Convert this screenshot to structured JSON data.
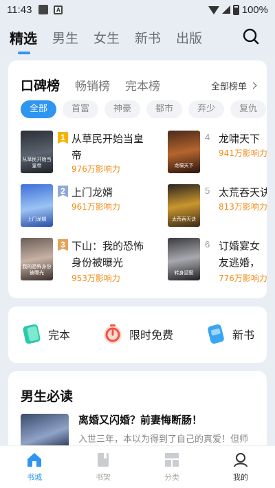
{
  "status": {
    "time": "11:43",
    "battery": "100%"
  },
  "nav": {
    "tabs": [
      "精选",
      "男生",
      "女生",
      "新书",
      "出版"
    ],
    "active": 0
  },
  "ranking": {
    "tabs": [
      "口碑榜",
      "畅销榜",
      "完本榜"
    ],
    "all_label": "全部榜单",
    "chips": [
      "全部",
      "首富",
      "神豪",
      "都市",
      "弃少",
      "复仇"
    ],
    "books": [
      {
        "rank": "1",
        "title": "从草民开始当皇帝",
        "heat": "976万影响力",
        "cover_text": "从草民开始当皇帝"
      },
      {
        "rank": "2",
        "title": "上门龙婿",
        "heat": "961万影响力",
        "cover_text": "上门龙婿"
      },
      {
        "rank": "3",
        "title": "下山：我的恐怖身份被曝光",
        "heat": "953万影响力",
        "cover_text": "我的恐怖身份被曝光"
      },
      {
        "rank": "4",
        "title": "龙啸天下",
        "heat": "941万影响力",
        "cover_text": "龙啸天下"
      },
      {
        "rank": "5",
        "title": "太荒吞天诀",
        "heat": "813万影响力",
        "cover_text": "太荒吞天诀"
      },
      {
        "rank": "6",
        "title": "订婚宴女友逃婚，我，转身",
        "heat": "776万影响力",
        "cover_text": "转身迎娶"
      }
    ]
  },
  "quick": [
    {
      "label": "完本",
      "icon": "book-complete-icon"
    },
    {
      "label": "限时免费",
      "icon": "timer-icon"
    },
    {
      "label": "新书",
      "icon": "new-book-icon"
    }
  ],
  "must_read": {
    "title": "男生必读",
    "book": {
      "name": "离婚又闪婚？前妻悔断肠！",
      "desc": "入世三年，本以为得到了自己的真爱！但师"
    }
  },
  "bottom_nav": [
    "书城",
    "书架",
    "分类",
    "我的"
  ],
  "colors": {
    "accent": "#2e95f0",
    "heat": "#f08c1a",
    "rank1": "#f5b400",
    "rank2": "#8fa9d6",
    "rank3": "#e3a35c"
  }
}
